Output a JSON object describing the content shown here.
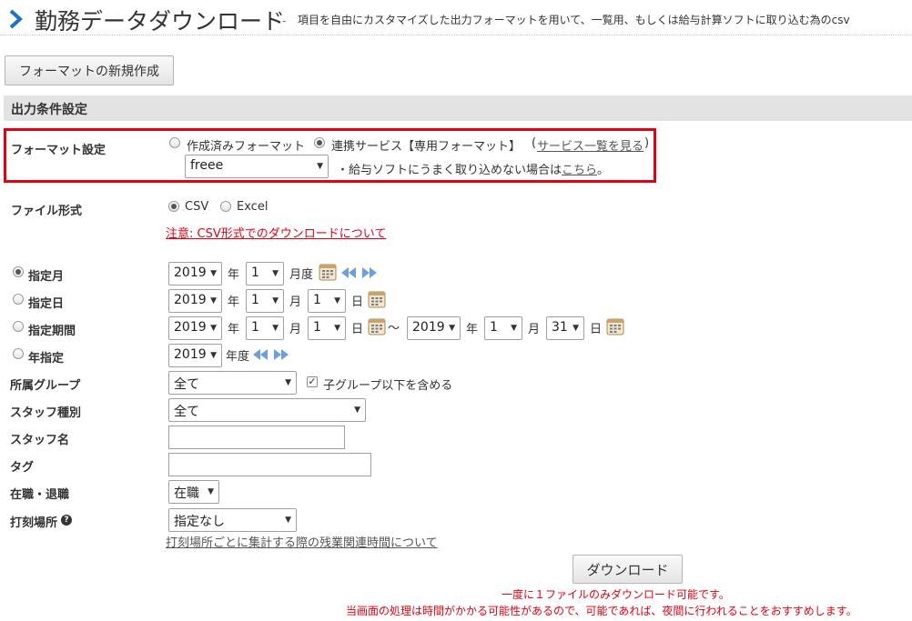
{
  "header": {
    "title": "勤務データダウンロード",
    "separator": "-",
    "subtitle": "項目を自由にカスタマイズした出力フォーマットを用いて、一覧用、もしくは給与計算ソフトに取り込む為のcsv"
  },
  "toolbar": {
    "new_format_label": "フォーマットの新規作成"
  },
  "section": {
    "title": "出力条件設定"
  },
  "format": {
    "label": "フォーマット設定",
    "options": [
      "作成済みフォーマット",
      "連携サービス【専用フォーマット】"
    ],
    "selected": 1,
    "paren_open": "(",
    "service_list_link": "サービス一覧を見る",
    "paren_close": ")",
    "service_value": "freee",
    "hint_prefix": "・給与ソフトにうまく取り込めない場合は",
    "hint_link": "こちら",
    "hint_suffix": "。"
  },
  "file_format": {
    "label": "ファイル形式",
    "options": [
      "CSV",
      "Excel"
    ],
    "selected": 0,
    "notice_link": "注意: CSV形式でのダウンロードについて"
  },
  "period": {
    "month": {
      "label": "指定月",
      "checked": true,
      "year": "2019",
      "year_unit": "年",
      "month": "1",
      "month_unit": "月度"
    },
    "day": {
      "label": "指定日",
      "checked": false,
      "year": "2019",
      "year_unit": "年",
      "month": "1",
      "month_unit": "月",
      "day": "1",
      "day_unit": "日"
    },
    "range": {
      "label": "指定期間",
      "checked": false,
      "from_year": "2019",
      "from_month": "1",
      "from_day": "1",
      "tilde": "～",
      "to_year": "2019",
      "to_month": "1",
      "to_day": "31",
      "year_unit": "年",
      "month_unit": "月",
      "day_unit": "日"
    },
    "year": {
      "label": "年指定",
      "checked": false,
      "year": "2019",
      "year_unit": "年度"
    }
  },
  "filters": {
    "group": {
      "label": "所属グループ",
      "value": "全て",
      "include_sub_label": "子グループ以下を含める",
      "include_sub_checked": true
    },
    "staff_type": {
      "label": "スタッフ種別",
      "value": "全て"
    },
    "staff_name": {
      "label": "スタッフ名",
      "value": ""
    },
    "tag": {
      "label": "タグ",
      "value": ""
    },
    "employment": {
      "label": "在職・退職",
      "value": "在職"
    },
    "location": {
      "label": "打刻場所",
      "help": "?",
      "value": "指定なし",
      "link": "打刻場所ごとに集計する際の残業関連時間について"
    }
  },
  "download": {
    "button_label": "ダウンロード",
    "note1": "一度に１ファイルのみダウンロード可能です。",
    "note2": "当画面の処理は時間がかかる可能性があるので、可能であれば、夜間に行われることをおすすめします。"
  },
  "colors": {
    "accent_blue": "#1a73c8",
    "highlight_red": "#e60012",
    "section_bg": "#e3e3e3"
  },
  "icons": {
    "calendar": "calendar-icon",
    "prev": "prev-arrows-icon",
    "next": "next-arrows-icon",
    "help": "question-circle-icon"
  }
}
